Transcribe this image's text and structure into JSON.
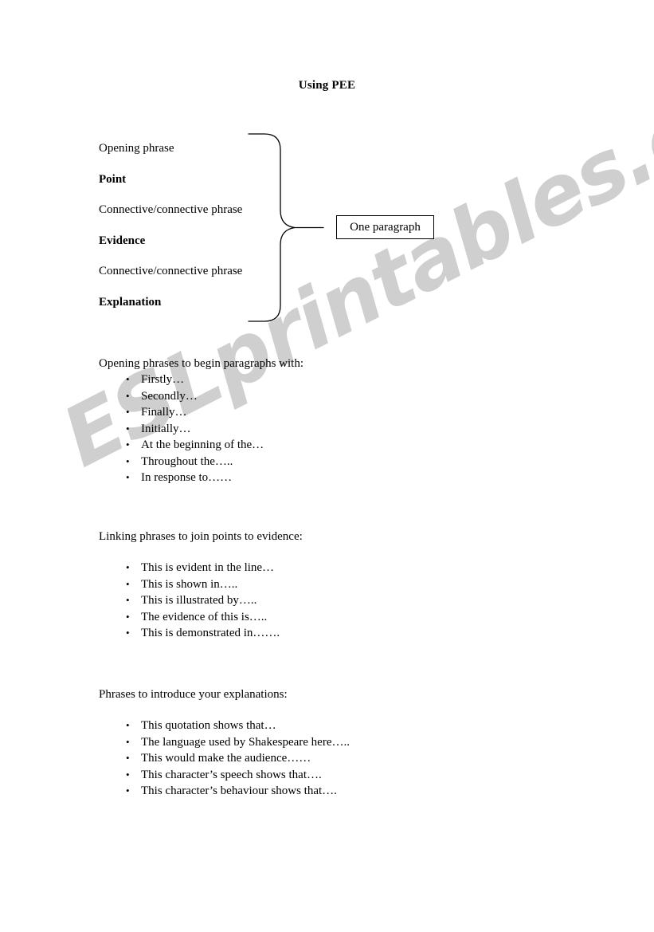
{
  "document": {
    "title": "Using PEE"
  },
  "watermark": {
    "text": "ESLprintables.com",
    "color": "#cfcfcf"
  },
  "diagram": {
    "rows": [
      {
        "label": "Opening phrase",
        "bold": false
      },
      {
        "label": "Point",
        "bold": true
      },
      {
        "label": "Connective/connective phrase",
        "bold": false
      },
      {
        "label": "Evidence",
        "bold": true
      },
      {
        "label": "Connective/connective phrase",
        "bold": false
      },
      {
        "label": "Explanation",
        "bold": true
      }
    ],
    "callout_label": "One paragraph"
  },
  "sections": [
    {
      "heading": "Opening phrases to begin paragraphs with:",
      "items": [
        "Firstly…",
        "Secondly…",
        "Finally…",
        "Initially…",
        "At the beginning of the…",
        "Throughout the…..",
        "In response to……"
      ]
    },
    {
      "heading": "Linking phrases to join points to evidence:",
      "items": [
        "This is evident in the line…",
        "This is shown in…..",
        "This is illustrated by…..",
        "The evidence of this is…..",
        "This is demonstrated in……."
      ]
    },
    {
      "heading": "Phrases to introduce your explanations:",
      "items": [
        "This quotation shows that…",
        "The language used by Shakespeare here…..",
        "This would make the audience……",
        "This character’s speech shows that….",
        "This character’s behaviour shows that…."
      ]
    }
  ]
}
